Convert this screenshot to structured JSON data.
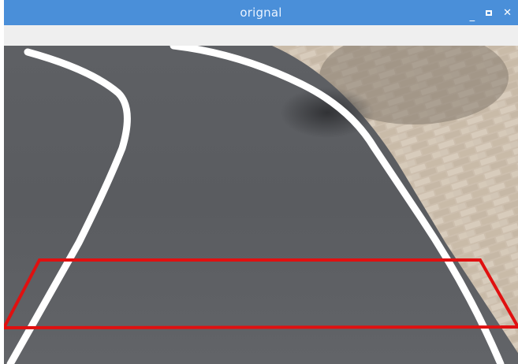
{
  "window": {
    "title": "orignal",
    "controls": {
      "minimize_glyph": "_",
      "close_glyph": "✕"
    }
  },
  "colors": {
    "titlebar": "#4a8fd9",
    "toolbar": "#efefef",
    "asphalt": "#5a5c60",
    "paving": "#cfc3b3",
    "lane_line": "#ffffff",
    "roi_box": "#e01010"
  },
  "image": {
    "description_icon": "camera-frame-icon"
  }
}
